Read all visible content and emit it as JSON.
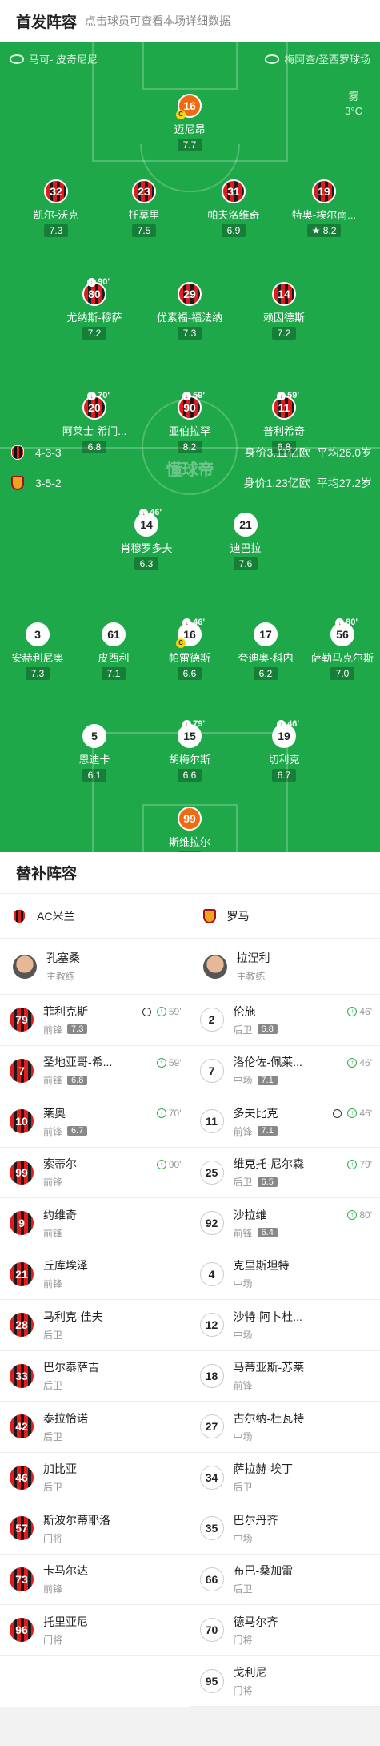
{
  "header": {
    "title": "首发阵容",
    "subtitle": "点击球员可查看本场详细数据"
  },
  "pitch": {
    "home_team": "马可- 皮奇尼尼",
    "away_venue": "梅阿查/圣西罗球场",
    "weather": "雾",
    "temperature": "3°C",
    "watermark": "懂球帝",
    "home": {
      "formation": "4-3-3",
      "value": "身价3.11亿欧",
      "age": "平均26.0岁"
    },
    "away": {
      "formation": "3-5-2",
      "value": "身价1.23亿欧",
      "age": "平均27.2岁"
    },
    "players": [
      {
        "num": "16",
        "name": "迈尼昂",
        "rating": "7.7",
        "team": "gk",
        "captain": true
      },
      {
        "num": "32",
        "name": "凯尔-沃克",
        "rating": "7.3",
        "team": "m"
      },
      {
        "num": "23",
        "name": "托莫里",
        "rating": "7.5",
        "team": "m"
      },
      {
        "num": "31",
        "name": "帕夫洛维奇",
        "rating": "6.9",
        "team": "m"
      },
      {
        "num": "19",
        "name": "特奥-埃尔南...",
        "rating": "8.2",
        "team": "m",
        "best": true
      },
      {
        "num": "80",
        "name": "尤纳斯-穆萨",
        "rating": "7.2",
        "team": "m",
        "sub": "90'"
      },
      {
        "num": "29",
        "name": "优素福-福法纳",
        "rating": "7.3",
        "team": "m"
      },
      {
        "num": "14",
        "name": "赖因德斯",
        "rating": "7.2",
        "team": "m"
      },
      {
        "num": "20",
        "name": "阿莱士-希门...",
        "rating": "6.8",
        "team": "m",
        "sub": "70'"
      },
      {
        "num": "90",
        "name": "亚伯拉罕",
        "rating": "8.2",
        "team": "m",
        "sub": "59'"
      },
      {
        "num": "11",
        "name": "普利希奇",
        "rating": "6.8",
        "team": "m",
        "sub": "59'"
      },
      {
        "num": "14",
        "name": "肖穆罗多夫",
        "rating": "6.3",
        "team": "r",
        "sub": "46'"
      },
      {
        "num": "21",
        "name": "迪巴拉",
        "rating": "7.6",
        "team": "r"
      },
      {
        "num": "3",
        "name": "安赫利尼奥",
        "rating": "7.3",
        "team": "r"
      },
      {
        "num": "61",
        "name": "皮西利",
        "rating": "7.1",
        "team": "r"
      },
      {
        "num": "16",
        "name": "帕雷德斯",
        "rating": "6.6",
        "team": "r",
        "sub": "46'",
        "captain": true
      },
      {
        "num": "17",
        "name": "夸迪奥-科内",
        "rating": "6.2",
        "team": "r"
      },
      {
        "num": "56",
        "name": "萨勒马克尔斯",
        "rating": "7.0",
        "team": "r",
        "sub": "80'"
      },
      {
        "num": "5",
        "name": "恩迪卡",
        "rating": "6.1",
        "team": "r"
      },
      {
        "num": "15",
        "name": "胡梅尔斯",
        "rating": "6.6",
        "team": "r",
        "sub": "79'"
      },
      {
        "num": "19",
        "name": "切利克",
        "rating": "6.7",
        "team": "r",
        "sub": "46'"
      },
      {
        "num": "99",
        "name": "斯维拉尔",
        "rating": "6.5",
        "team": "gk"
      }
    ]
  },
  "subs": {
    "title": "替补阵容",
    "home": {
      "team": "AC米兰",
      "coach": "孔塞桑",
      "coach_role": "主教练",
      "players": [
        {
          "num": "79",
          "name": "菲利克斯",
          "pos": "前锋",
          "rating": "7.3",
          "time": "59'",
          "goal": true
        },
        {
          "num": "7",
          "name": "圣地亚哥-希...",
          "pos": "前锋",
          "rating": "6.8",
          "time": "59'"
        },
        {
          "num": "10",
          "name": "莱奥",
          "pos": "前锋",
          "rating": "6.7",
          "time": "70'"
        },
        {
          "num": "99",
          "name": "索蒂尔",
          "pos": "前锋",
          "time": "90'"
        },
        {
          "num": "9",
          "name": "约维奇",
          "pos": "前锋"
        },
        {
          "num": "21",
          "name": "丘库埃泽",
          "pos": "前锋"
        },
        {
          "num": "28",
          "name": "马利克-佳夫",
          "pos": "后卫"
        },
        {
          "num": "33",
          "name": "巴尔泰萨吉",
          "pos": "后卫"
        },
        {
          "num": "42",
          "name": "泰拉恰诺",
          "pos": "后卫"
        },
        {
          "num": "46",
          "name": "加比亚",
          "pos": "后卫"
        },
        {
          "num": "57",
          "name": "斯波尔蒂耶洛",
          "pos": "门将"
        },
        {
          "num": "73",
          "name": "卡马尔达",
          "pos": "前锋"
        },
        {
          "num": "96",
          "name": "托里亚尼",
          "pos": "门将"
        }
      ]
    },
    "away": {
      "team": "罗马",
      "coach": "拉涅利",
      "coach_role": "主教练",
      "players": [
        {
          "num": "2",
          "name": "伦施",
          "pos": "后卫",
          "rating": "6.8",
          "time": "46'"
        },
        {
          "num": "7",
          "name": "洛伦佐-佩莱...",
          "pos": "中场",
          "rating": "7.1",
          "time": "46'"
        },
        {
          "num": "11",
          "name": "多夫比克",
          "pos": "前锋",
          "rating": "7.1",
          "time": "46'",
          "goal": true
        },
        {
          "num": "25",
          "name": "维克托-尼尔森",
          "pos": "后卫",
          "rating": "6.5",
          "time": "79'"
        },
        {
          "num": "92",
          "name": "沙拉维",
          "pos": "前锋",
          "rating": "6.4",
          "time": "80'"
        },
        {
          "num": "4",
          "name": "克里斯坦特",
          "pos": "中场"
        },
        {
          "num": "12",
          "name": "沙特-阿卜杜...",
          "pos": "中场"
        },
        {
          "num": "18",
          "name": "马蒂亚斯-苏莱",
          "pos": "前锋"
        },
        {
          "num": "27",
          "name": "古尔纳-杜瓦特",
          "pos": "中场"
        },
        {
          "num": "34",
          "name": "萨拉赫-埃丁",
          "pos": "后卫"
        },
        {
          "num": "35",
          "name": "巴尔丹齐",
          "pos": "中场"
        },
        {
          "num": "66",
          "name": "布巴-桑加雷",
          "pos": "后卫"
        },
        {
          "num": "70",
          "name": "德马尔齐",
          "pos": "门将"
        },
        {
          "num": "95",
          "name": "戈利尼",
          "pos": "门将"
        }
      ]
    }
  }
}
